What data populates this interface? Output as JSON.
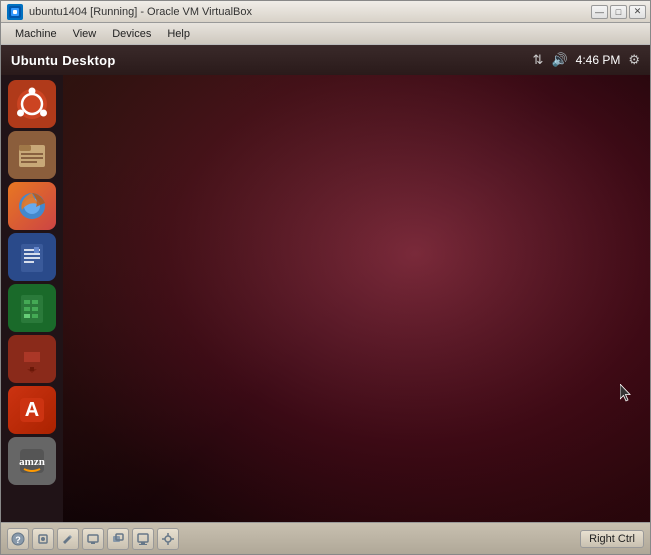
{
  "window": {
    "title": "ubuntu1404 [Running] - Oracle VM VirtualBox",
    "icon_label": "VB"
  },
  "window_controls": {
    "minimize_label": "—",
    "maximize_label": "□",
    "close_label": "✕"
  },
  "menu_bar": {
    "items": [
      "Machine",
      "View",
      "Devices",
      "Help"
    ]
  },
  "ubuntu_topbar": {
    "title": "Ubuntu Desktop",
    "time": "4:46 PM",
    "icons": [
      "arrows-icon",
      "volume-icon",
      "settings-icon"
    ]
  },
  "launcher": {
    "items": [
      {
        "id": "ubuntu-logo",
        "label": "Ubuntu Logo",
        "type": "ubuntu"
      },
      {
        "id": "files",
        "label": "Files",
        "type": "files"
      },
      {
        "id": "firefox",
        "label": "Firefox",
        "type": "firefox"
      },
      {
        "id": "writer",
        "label": "LibreOffice Writer",
        "type": "writer"
      },
      {
        "id": "calc",
        "label": "LibreOffice Calc",
        "type": "calc"
      },
      {
        "id": "impress",
        "label": "LibreOffice Impress",
        "type": "impress"
      },
      {
        "id": "appstore",
        "label": "Ubuntu Software Center",
        "type": "appstore"
      },
      {
        "id": "amazon",
        "label": "Amazon",
        "type": "amazon"
      }
    ]
  },
  "taskbar": {
    "buttons": [
      "help-icon",
      "network-icon",
      "edit-icon",
      "display-icon",
      "window-icon",
      "screen-icon",
      "settings2-icon"
    ],
    "right_ctrl_label": "Right Ctrl"
  },
  "colors": {
    "accent": "#b03a1a",
    "desktop_bg": "#3a0a15",
    "launcher_bg": "rgba(30,15,20,0.85)"
  }
}
